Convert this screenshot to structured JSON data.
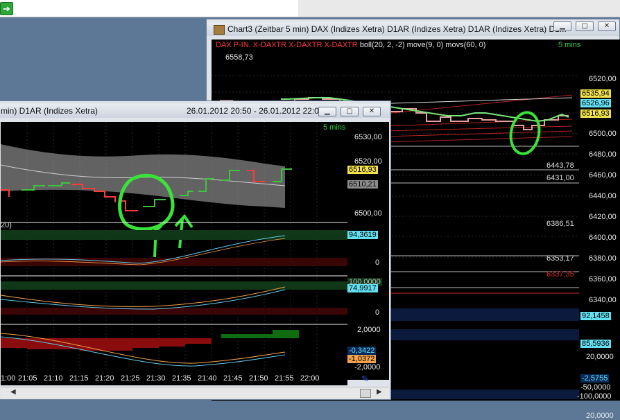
{
  "app": {
    "go_glyph": "➔"
  },
  "chart3": {
    "title": "Chart3 (Zeitbar 5 min)  DAX (Indizes Xetra) D1AR (Indizes Xetra) D1AR (Indizes Xetra) D1...",
    "legend_symbol": "DAX P-IN. X-DAXTR X-DAXTR X-DAXTR",
    "legend_indicators": "boll(20, 2, -2) move(9, 0) movs(60, 0)",
    "interval": "5 mins",
    "top_value": "6558,73",
    "price_axis": [
      "6520,00",
      "6500,00",
      "6480,00",
      "6460,00",
      "6440,00",
      "6420,00",
      "6400,00",
      "6380,00",
      "6360,00",
      "6340,00"
    ],
    "tags": [
      {
        "text": "6535,94",
        "color": "#f2e24a"
      },
      {
        "text": "6526,96",
        "color": "#63e1f2"
      },
      {
        "text": "6516,93",
        "color": "#f2e24a"
      }
    ],
    "levels": [
      {
        "text": "6443,78",
        "color": "#e6e6e6"
      },
      {
        "text": "6431,00",
        "color": "#e6e6e6"
      },
      {
        "text": "6386,51",
        "color": "#e6e6e6"
      },
      {
        "text": "6353,17",
        "color": "#e6e6e6"
      },
      {
        "text": "6337,35",
        "color": "#d62a2a"
      }
    ],
    "osc_tags": [
      "92,1458",
      "85,5936",
      "-2,5755"
    ],
    "osc_axis": [
      "20,0000",
      "-50,0000",
      "-100,0000",
      "20,0000"
    ]
  },
  "chart_small": {
    "title": "min)  D1AR (Indizes Xetra)",
    "range": "26.01.2012 20:50 - 26.01.2012 22:05",
    "interval": "5 mins",
    "price_axis": [
      "6530,00",
      "6520,00",
      "6500,00"
    ],
    "tags": [
      {
        "text": "6516,93",
        "color": "#f2e24a"
      },
      {
        "text": "6510,21",
        "color": "#8c8c8c"
      }
    ],
    "ind1_label": "20)",
    "ind1_tag": "94,3619",
    "ind1_axis": "0",
    "ind2_tag": "74,9917",
    "ind2_axis_top": "100,0000",
    "ind2_axis": "0",
    "ind3_axis": [
      "2,0000",
      "-2,0000"
    ],
    "ind3_tags": [
      {
        "text": "-0,3422",
        "color": "#63e1f2"
      },
      {
        "text": "-1,0372",
        "color": "#f2a24a"
      }
    ],
    "time_axis": [
      "1:00",
      "21:05",
      "21:10",
      "21:15",
      "21:20",
      "21:25",
      "21:30",
      "21:35",
      "21:40",
      "21:45",
      "21:50",
      "21:55",
      "22:00"
    ]
  }
}
